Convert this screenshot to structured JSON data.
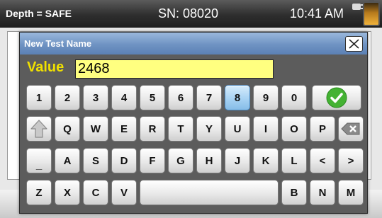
{
  "status_bar": {
    "depth": "Depth = SAFE",
    "serial": "SN: 08020",
    "time": "10:41 AM",
    "plug_icon": "plug-icon",
    "battery_icon": "battery-icon"
  },
  "dialog": {
    "title": "New Test Name",
    "close_icon": "close-icon",
    "value_label": "Value",
    "value": "2468"
  },
  "keyboard": {
    "highlighted_key": "8",
    "row1": [
      "1",
      "2",
      "3",
      "4",
      "5",
      "6",
      "7",
      "8",
      "9",
      "0"
    ],
    "row2": [
      "Q",
      "W",
      "E",
      "R",
      "T",
      "Y",
      "U",
      "I",
      "O",
      "P"
    ],
    "row3": [
      "_",
      "A",
      "S",
      "D",
      "F",
      "G",
      "H",
      "J",
      "K",
      "L",
      "<",
      ">"
    ],
    "row4_left": [
      "Z",
      "X",
      "C",
      "V"
    ],
    "row4_right": [
      "B",
      "N",
      "M"
    ],
    "enter_icon": "checkmark-icon",
    "shift_icon": "shift-arrow-icon",
    "backspace_icon": "backspace-icon",
    "colors": {
      "enter_green": "#44b233",
      "highlight_blue": "#a7d2f3",
      "value_label": "#f0e000",
      "value_field": "#ffff80",
      "titlebar": "#6f93c3"
    }
  }
}
